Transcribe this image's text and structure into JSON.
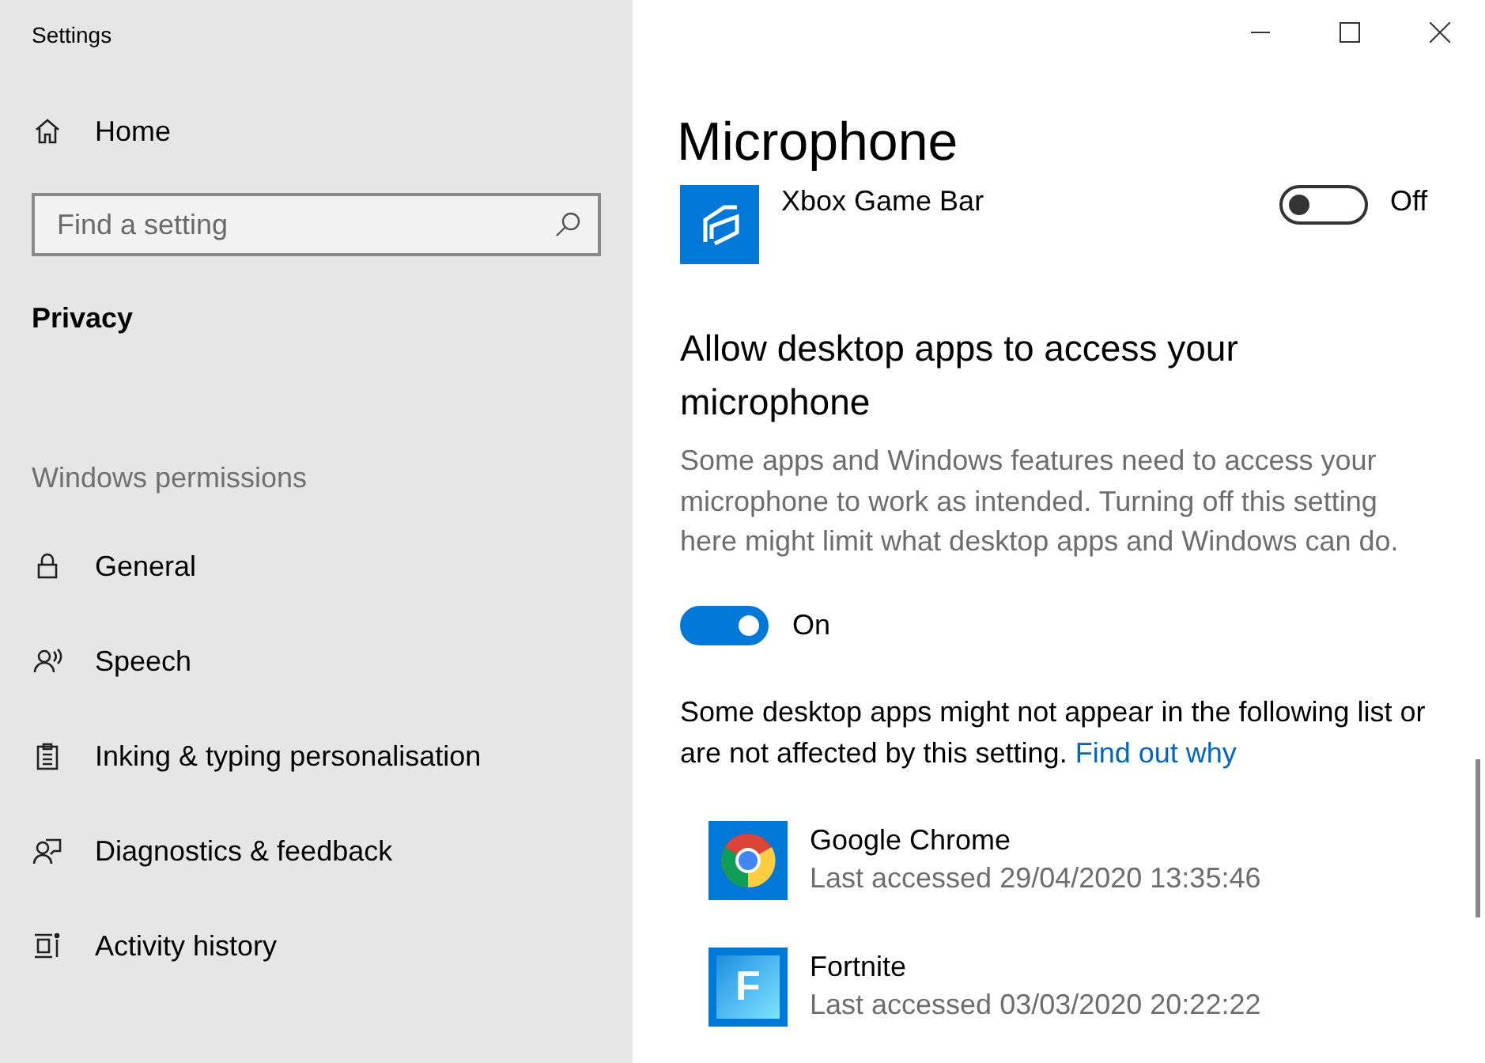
{
  "window": {
    "title": "Settings"
  },
  "sidebar": {
    "home": "Home",
    "search": {
      "placeholder": "Find a setting"
    },
    "section": "Privacy",
    "group": "Windows permissions",
    "items": [
      {
        "label": "General",
        "kind": "lock"
      },
      {
        "label": "Speech",
        "kind": "speech"
      },
      {
        "label": "Inking & typing personalisation",
        "kind": "clipboard"
      },
      {
        "label": "Diagnostics & feedback",
        "kind": "feedback"
      },
      {
        "label": "Activity history",
        "kind": "history"
      }
    ]
  },
  "page": {
    "title": "Microphone",
    "top_app": {
      "name": "Xbox Game Bar",
      "on": false,
      "state": "Off"
    },
    "desktop_section": {
      "heading": "Allow desktop apps to access your microphone",
      "description": "Some apps and Windows features need to access your microphone to work as intended. Turning off this setting here might limit what desktop apps and Windows can do.",
      "toggle": {
        "on": true,
        "state": "On"
      },
      "note": "Some desktop apps might not appear in the following list or are not affected by this setting.",
      "link": "Find out why"
    },
    "apps": [
      {
        "name": "Google Chrome",
        "kind": "chrome",
        "last_accessed": "Last accessed 29/04/2020 13:35:46"
      },
      {
        "name": "Fortnite",
        "kind": "letter",
        "icon_text": "F",
        "last_accessed": "Last accessed 03/03/2020 20:22:22"
      }
    ]
  }
}
